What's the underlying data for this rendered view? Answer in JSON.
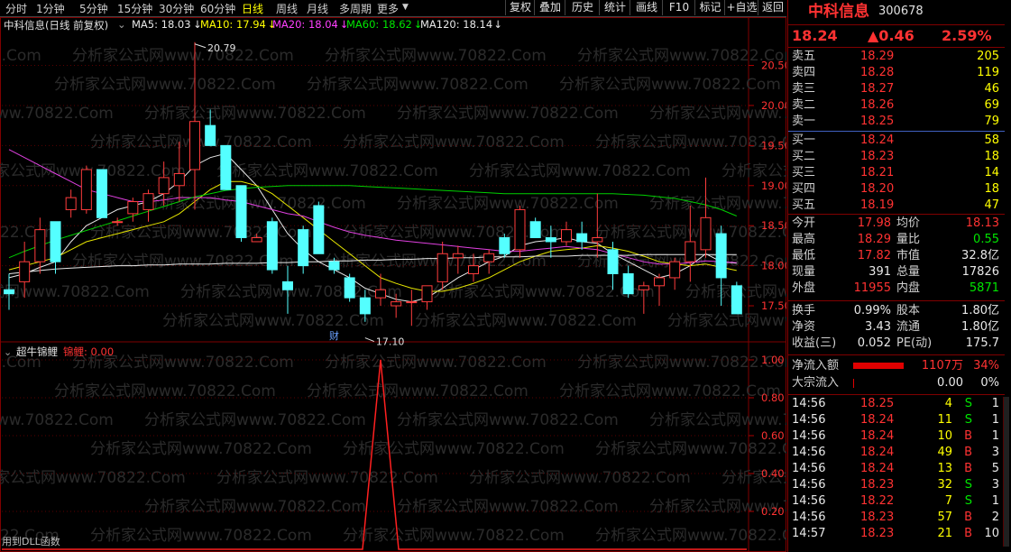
{
  "toolbar": {
    "periods": [
      "分时",
      "1分钟",
      "5分钟",
      "15分钟",
      "30分钟",
      "60分钟",
      "日线",
      "周线",
      "月线",
      "多周期",
      "更多"
    ],
    "active_period": "日线",
    "right_buttons": [
      "复权",
      "叠加",
      "历史",
      "统计",
      "画线",
      "F10",
      "标记",
      "+自选",
      "返回"
    ]
  },
  "main_chart": {
    "title": "中科信息(日线 前复权)",
    "ma_labels": [
      {
        "text": "MA5: 18.03",
        "color": "#e8e8e8"
      },
      {
        "text": "MA10: 17.94",
        "color": "#ffff00"
      },
      {
        "text": "MA20: 18.04",
        "color": "#ff40ff"
      },
      {
        "text": "MA60: 18.62",
        "color": "#00e600"
      },
      {
        "text": "MA120: 18.14",
        "color": "#e8e8e8"
      }
    ],
    "annotations": {
      "high": "20.79",
      "low": "17.10",
      "fin": "财"
    },
    "y_ticks": [
      "20.50",
      "20.00",
      "19.50",
      "19.00",
      "18.50",
      "18.00",
      "17.50"
    ],
    "candles": [
      [
        17.7,
        17.9,
        17.45,
        17.65
      ],
      [
        17.8,
        18.3,
        17.6,
        18.05
      ],
      [
        18.05,
        18.6,
        17.9,
        18.45
      ],
      [
        18.55,
        18.4,
        17.9,
        18.05
      ],
      [
        18.7,
        18.95,
        18.6,
        18.85
      ],
      [
        18.7,
        19.25,
        18.65,
        19.2
      ],
      [
        19.2,
        18.65,
        18.6,
        18.6
      ],
      [
        18.55,
        18.6,
        18.5,
        18.55
      ],
      [
        18.65,
        18.85,
        18.55,
        18.8
      ],
      [
        18.7,
        18.95,
        18.55,
        18.9
      ],
      [
        18.9,
        19.3,
        18.75,
        19.1
      ],
      [
        19.0,
        19.55,
        18.8,
        19.15
      ],
      [
        19.2,
        20.79,
        18.7,
        19.8
      ],
      [
        19.75,
        19.95,
        19.6,
        19.5
      ],
      [
        19.5,
        19.25,
        18.95,
        18.95
      ],
      [
        19.0,
        18.9,
        18.3,
        18.35
      ],
      [
        18.3,
        18.4,
        18.3,
        18.35
      ],
      [
        18.55,
        18.6,
        17.9,
        17.95
      ],
      [
        17.8,
        18.0,
        17.4,
        17.7
      ],
      [
        18.45,
        18.5,
        17.9,
        18.0
      ],
      [
        18.75,
        18.8,
        18.2,
        18.15
      ],
      [
        18.05,
        18.1,
        17.9,
        17.95
      ],
      [
        17.85,
        17.9,
        17.55,
        17.6
      ],
      [
        17.6,
        17.7,
        17.3,
        17.4
      ],
      [
        17.6,
        17.9,
        17.5,
        17.7
      ],
      [
        17.5,
        17.65,
        17.35,
        17.55
      ],
      [
        17.55,
        17.7,
        17.25,
        17.55
      ],
      [
        17.55,
        17.75,
        17.45,
        17.75
      ],
      [
        17.8,
        18.3,
        17.7,
        18.15
      ],
      [
        18.1,
        18.25,
        17.9,
        18.15
      ],
      [
        17.9,
        18.15,
        17.8,
        18.0
      ],
      [
        18.05,
        18.2,
        17.9,
        18.15
      ],
      [
        18.35,
        18.4,
        18.1,
        18.15
      ],
      [
        18.2,
        18.75,
        18.1,
        18.7
      ],
      [
        18.55,
        18.6,
        18.4,
        18.35
      ],
      [
        18.35,
        18.5,
        18.1,
        18.3
      ],
      [
        18.3,
        18.55,
        18.25,
        18.45
      ],
      [
        18.4,
        18.55,
        18.2,
        18.3
      ],
      [
        18.3,
        18.9,
        18.1,
        18.35
      ],
      [
        18.2,
        18.3,
        17.7,
        17.9
      ],
      [
        17.9,
        18.0,
        17.6,
        17.65
      ],
      [
        17.7,
        17.8,
        17.4,
        17.75
      ],
      [
        17.75,
        17.9,
        17.5,
        17.85
      ],
      [
        17.85,
        18.1,
        17.7,
        18.05
      ],
      [
        18.05,
        18.75,
        17.8,
        18.3
      ],
      [
        18.2,
        19.1,
        18.1,
        18.6
      ],
      [
        18.4,
        18.5,
        17.5,
        17.85
      ],
      [
        17.75,
        17.8,
        17.55,
        17.4
      ]
    ],
    "ma_lines": {
      "ma5": [
        17.85,
        17.9,
        17.98,
        18.05,
        18.3,
        18.5,
        18.6,
        18.7,
        18.75,
        18.8,
        18.9,
        19.05,
        19.25,
        19.35,
        19.4,
        19.2,
        19.0,
        18.7,
        18.4,
        18.2,
        18.05,
        17.95,
        17.85,
        17.72,
        17.65,
        17.58,
        17.55,
        17.6,
        17.72,
        17.85,
        17.95,
        18.05,
        18.12,
        18.25,
        18.3,
        18.32,
        18.35,
        18.3,
        18.28,
        18.15,
        18.05,
        17.95,
        17.85,
        17.9,
        18.0,
        18.15,
        18.05,
        18.03
      ],
      "ma10": [
        17.95,
        18.0,
        18.05,
        18.1,
        18.2,
        18.3,
        18.35,
        18.4,
        18.45,
        18.5,
        18.55,
        18.65,
        18.8,
        18.95,
        19.05,
        19.05,
        19.0,
        18.9,
        18.75,
        18.6,
        18.45,
        18.3,
        18.15,
        18.0,
        17.85,
        17.78,
        17.72,
        17.68,
        17.68,
        17.72,
        17.78,
        17.85,
        17.95,
        18.05,
        18.12,
        18.18,
        18.2,
        18.22,
        18.25,
        18.22,
        18.18,
        18.12,
        18.05,
        18.02,
        18.0,
        18.02,
        17.98,
        17.94
      ],
      "ma20": [
        19.45,
        19.35,
        19.25,
        19.15,
        19.05,
        18.95,
        18.9,
        18.85,
        18.8,
        18.8,
        18.82,
        18.85,
        18.85,
        18.85,
        18.82,
        18.8,
        18.75,
        18.7,
        18.65,
        18.62,
        18.55,
        18.48,
        18.42,
        18.38,
        18.35,
        18.32,
        18.3,
        18.28,
        18.26,
        18.24,
        18.22,
        18.2,
        18.18,
        18.18,
        18.2,
        18.22,
        18.24,
        18.22,
        18.2,
        18.15,
        18.1,
        18.05,
        18.02,
        18.02,
        18.04,
        18.06,
        18.05,
        18.04
      ],
      "ma60": [
        18.1,
        18.18,
        18.25,
        18.32,
        18.38,
        18.44,
        18.5,
        18.56,
        18.62,
        18.68,
        18.74,
        18.8,
        18.86,
        18.9,
        18.94,
        18.96,
        18.98,
        18.99,
        19.0,
        19.0,
        19.0,
        19.0,
        19.0,
        18.99,
        18.98,
        18.97,
        18.96,
        18.95,
        18.94,
        18.93,
        18.92,
        18.91,
        18.9,
        18.9,
        18.9,
        18.9,
        18.9,
        18.9,
        18.9,
        18.9,
        18.89,
        18.88,
        18.86,
        18.84,
        18.8,
        18.76,
        18.7,
        18.62
      ],
      "ma120": [
        17.9,
        17.92,
        17.94,
        17.96,
        17.97,
        17.98,
        17.99,
        18.0,
        18.0,
        18.01,
        18.01,
        18.02,
        18.02,
        18.02,
        18.03,
        18.03,
        18.03,
        18.04,
        18.04,
        18.05,
        18.05,
        18.06,
        18.06,
        18.07,
        18.07,
        18.08,
        18.08,
        18.09,
        18.09,
        18.1,
        18.1,
        18.11,
        18.11,
        18.11,
        18.12,
        18.12,
        18.12,
        18.13,
        18.13,
        18.13,
        18.13,
        18.14,
        18.14,
        18.14,
        18.14,
        18.14,
        18.14,
        18.14
      ]
    },
    "ylim": [
      17.05,
      20.9
    ]
  },
  "sub_chart": {
    "title": "超牛锦鲤",
    "indicator_label": "锦鲤: 0.00",
    "y_ticks": [
      "1.00",
      "0.80",
      "0.60",
      "0.40",
      "0.20"
    ],
    "spike_index": 24
  },
  "status_text": "用到DLL函数",
  "stock": {
    "name": "中科信息",
    "code": "300678",
    "price": "18.24",
    "change": "▲0.46",
    "pct": "2.59%"
  },
  "order_book": {
    "asks": [
      {
        "label": "卖五",
        "price": "18.29",
        "vol": "205"
      },
      {
        "label": "卖四",
        "price": "18.28",
        "vol": "119"
      },
      {
        "label": "卖三",
        "price": "18.27",
        "vol": "46"
      },
      {
        "label": "卖二",
        "price": "18.26",
        "vol": "69"
      },
      {
        "label": "卖一",
        "price": "18.25",
        "vol": "79"
      }
    ],
    "bids": [
      {
        "label": "买一",
        "price": "18.24",
        "vol": "58"
      },
      {
        "label": "买二",
        "price": "18.23",
        "vol": "18"
      },
      {
        "label": "买三",
        "price": "18.21",
        "vol": "14"
      },
      {
        "label": "买四",
        "price": "18.20",
        "vol": "18"
      },
      {
        "label": "买五",
        "price": "18.19",
        "vol": "47"
      }
    ]
  },
  "stats": [
    {
      "l1": "今开",
      "v1": "17.98",
      "c1": "red",
      "l2": "均价",
      "v2": "18.13",
      "c2": "red"
    },
    {
      "l1": "最高",
      "v1": "18.29",
      "c1": "red",
      "l2": "量比",
      "v2": "0.55",
      "c2": "grn"
    },
    {
      "l1": "最低",
      "v1": "17.82",
      "c1": "red",
      "l2": "市值",
      "v2": "32.8亿",
      "c2": "wht"
    },
    {
      "l1": "现量",
      "v1": "391",
      "c1": "wht",
      "l2": "总量",
      "v2": "17826",
      "c2": "wht"
    },
    {
      "l1": "外盘",
      "v1": "11955",
      "c1": "red",
      "l2": "内盘",
      "v2": "5871",
      "c2": "grn"
    }
  ],
  "stats2": [
    {
      "l1": "换手",
      "v1": "0.99%",
      "l2": "股本",
      "v2": "1.80亿"
    },
    {
      "l1": "净资",
      "v1": "3.43",
      "l2": "流通",
      "v2": "1.80亿"
    },
    {
      "l1": "收益(三)",
      "v1": "0.052",
      "l2": "PE(动)",
      "v2": "175.7"
    }
  ],
  "flow": {
    "net_label": "净流入额",
    "net_value": "1107万",
    "net_pct": "34%",
    "block_label": "大宗流入",
    "block_value": "0.00",
    "block_pct": "0%"
  },
  "ticks": [
    {
      "time": "14:56",
      "price": "18.25",
      "vol": "4",
      "bs": "S",
      "n": "1"
    },
    {
      "time": "14:56",
      "price": "18.24",
      "vol": "11",
      "bs": "S",
      "n": "1"
    },
    {
      "time": "14:56",
      "price": "18.24",
      "vol": "10",
      "bs": "B",
      "n": "1"
    },
    {
      "time": "14:56",
      "price": "18.24",
      "vol": "49",
      "bs": "B",
      "n": "3"
    },
    {
      "time": "14:56",
      "price": "18.24",
      "vol": "13",
      "bs": "B",
      "n": "5"
    },
    {
      "time": "14:56",
      "price": "18.23",
      "vol": "32",
      "bs": "S",
      "n": "3"
    },
    {
      "time": "14:56",
      "price": "18.22",
      "vol": "7",
      "bs": "S",
      "n": "1"
    },
    {
      "time": "14:56",
      "price": "18.23",
      "vol": "57",
      "bs": "B",
      "n": "2"
    },
    {
      "time": "14:57",
      "price": "18.23",
      "vol": "21",
      "bs": "B",
      "n": "10"
    }
  ],
  "watermark": "分析家公式网www.70822.Com"
}
